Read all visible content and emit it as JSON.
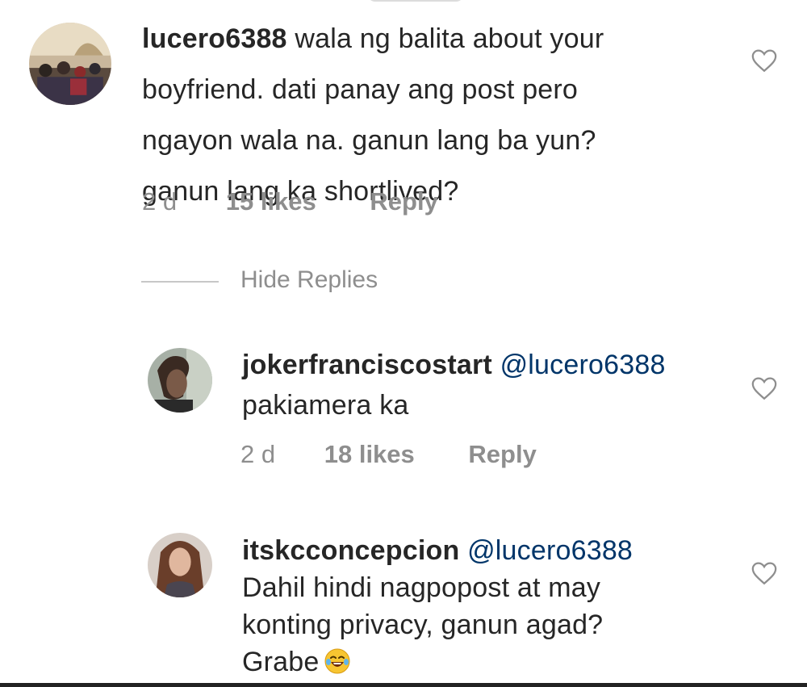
{
  "comments": [
    {
      "username": "lucero6388",
      "text_lines": [
        "wala ng balita about your",
        "boyfriend. dati panay ang post pero",
        "ngayon wala na. ganun lang ba yun?",
        "ganun lang ka shortlived?"
      ],
      "time": "2 d",
      "likes": "15 likes",
      "reply": "Reply",
      "avatar_icon": "group-photo"
    }
  ],
  "hide_replies": "Hide Replies",
  "replies": [
    {
      "username": "jokerfranciscostart",
      "mention": "@lucero6388",
      "text_lines": [
        "pakiamera ka"
      ],
      "time": "2 d",
      "likes": "18 likes",
      "reply": "Reply",
      "avatar_icon": "person-photo"
    },
    {
      "username": "itskcconcepcion",
      "mention": "@lucero6388",
      "text_lines": [
        "Dahil hindi nagpopost at may",
        "konting privacy, ganun agad?",
        "Grabe"
      ],
      "emoji": "laughing-tears-emoji",
      "avatar_icon": "woman-photo"
    }
  ],
  "colors": {
    "text": "#262626",
    "meta": "#8e8e8e",
    "mention": "#003569"
  }
}
